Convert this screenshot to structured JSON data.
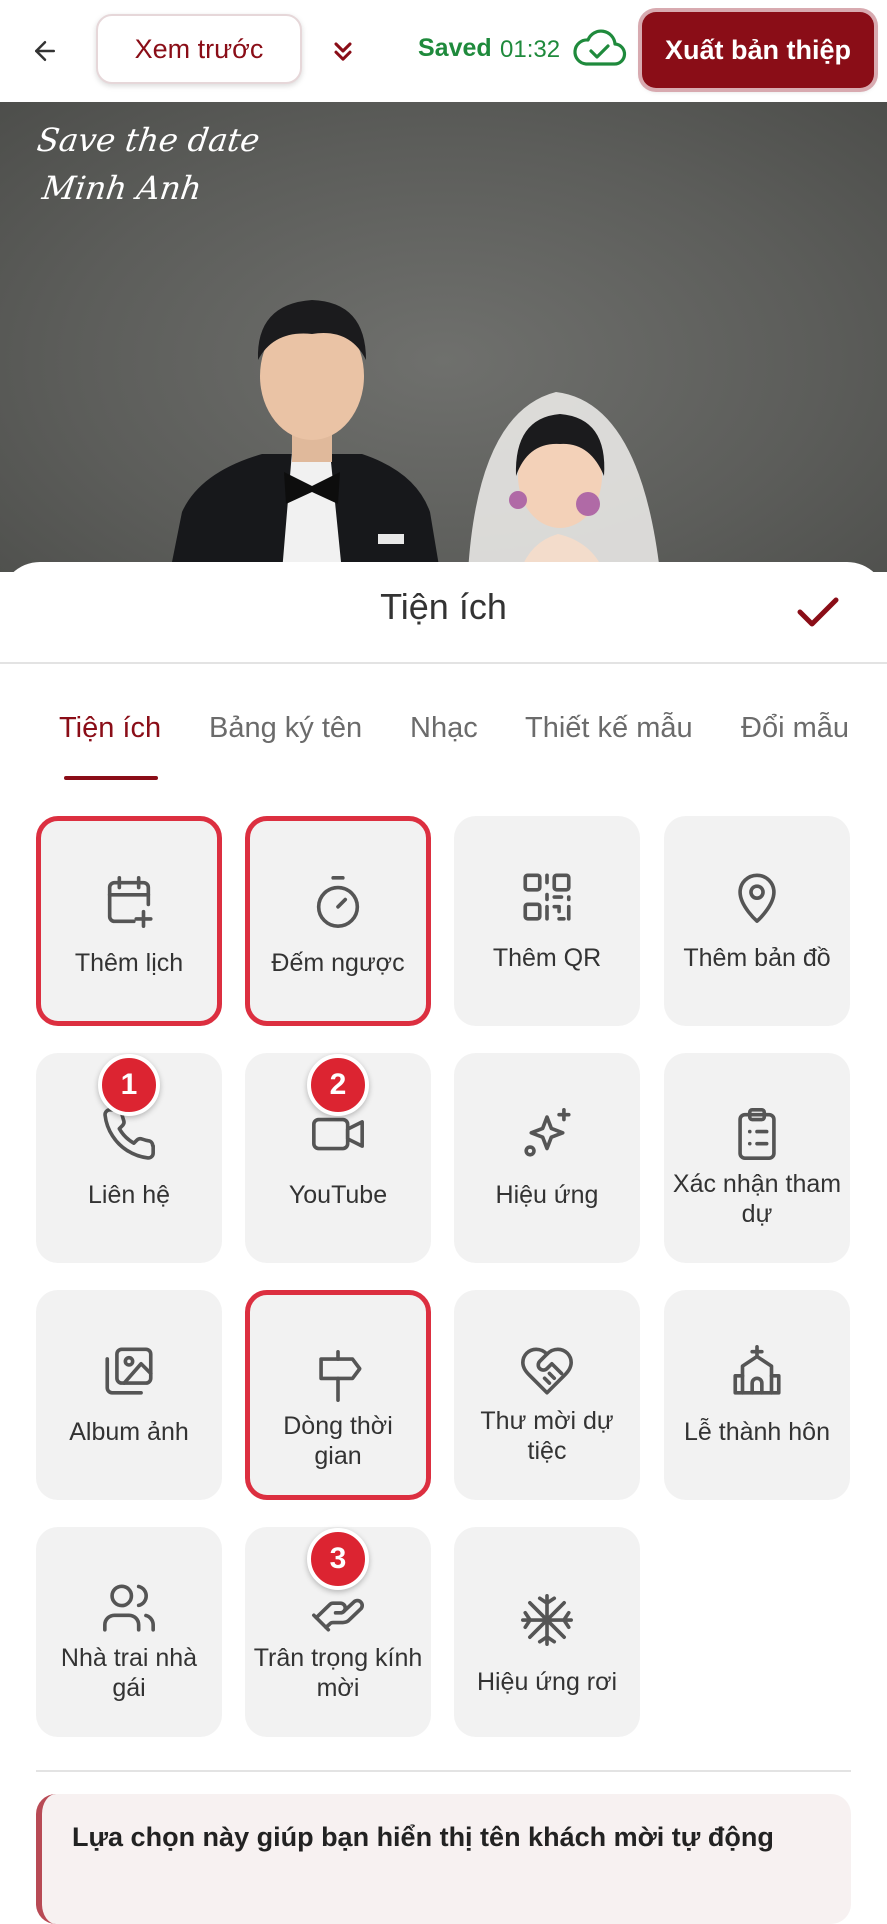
{
  "header": {
    "back_icon": "arrow-left-icon",
    "preview_label": "Xem trước",
    "expand_icon": "double-chevron-down-icon",
    "saved_label": "Saved",
    "saved_time": "01:32",
    "cloud_icon": "cloud-check-icon",
    "export_label": "Xuất bản thiệp"
  },
  "photo": {
    "script_line1": "Save the date",
    "script_line2": "Minh Anh"
  },
  "sheet": {
    "title": "Tiện ích",
    "confirm_icon": "check-icon"
  },
  "tabs": [
    {
      "label": "Tiện ích",
      "active": true
    },
    {
      "label": "Bảng ký tên"
    },
    {
      "label": "Nhạc"
    },
    {
      "label": "Thiết kế mẫu"
    },
    {
      "label": "Đổi mẫu"
    }
  ],
  "tiles": [
    {
      "label": "Thêm lịch",
      "icon": "calendar-plus-icon",
      "highlighted": true
    },
    {
      "label": "Đếm ngược",
      "icon": "stopwatch-icon",
      "highlighted": true
    },
    {
      "label": "Thêm QR",
      "icon": "qr-code-icon"
    },
    {
      "label": "Thêm bản đồ",
      "icon": "map-pin-icon"
    },
    {
      "label": "Liên hệ",
      "icon": "phone-icon",
      "badge": "1"
    },
    {
      "label": "YouTube",
      "icon": "video-camera-icon",
      "badge": "2"
    },
    {
      "label": "Hiệu ứng",
      "icon": "sparkles-icon"
    },
    {
      "label": "Xác nhận tham dự",
      "icon": "clipboard-icon"
    },
    {
      "label": "Album ảnh",
      "icon": "photo-album-icon"
    },
    {
      "label": "Dòng thời gian",
      "icon": "signpost-icon",
      "highlighted": true
    },
    {
      "label": "Thư mời dự tiệc",
      "icon": "heart-handshake-icon"
    },
    {
      "label": "Lễ thành hôn",
      "icon": "church-icon"
    },
    {
      "label": "Nhà trai nhà gái",
      "icon": "users-icon"
    },
    {
      "label": "Trân trọng kính mời",
      "icon": "hand-heart-icon",
      "badge": "3"
    },
    {
      "label": "Hiệu ứng rơi",
      "icon": "snowflake-icon"
    }
  ],
  "info": {
    "text": "Lựa chọn này giúp bạn hiển thị tên khách mời tự động"
  },
  "colors": {
    "brand": "#8a0d17",
    "saved_green": "#1f8a3c",
    "highlight_red": "#dc2f40",
    "tile_bg": "#f2f2f2"
  }
}
